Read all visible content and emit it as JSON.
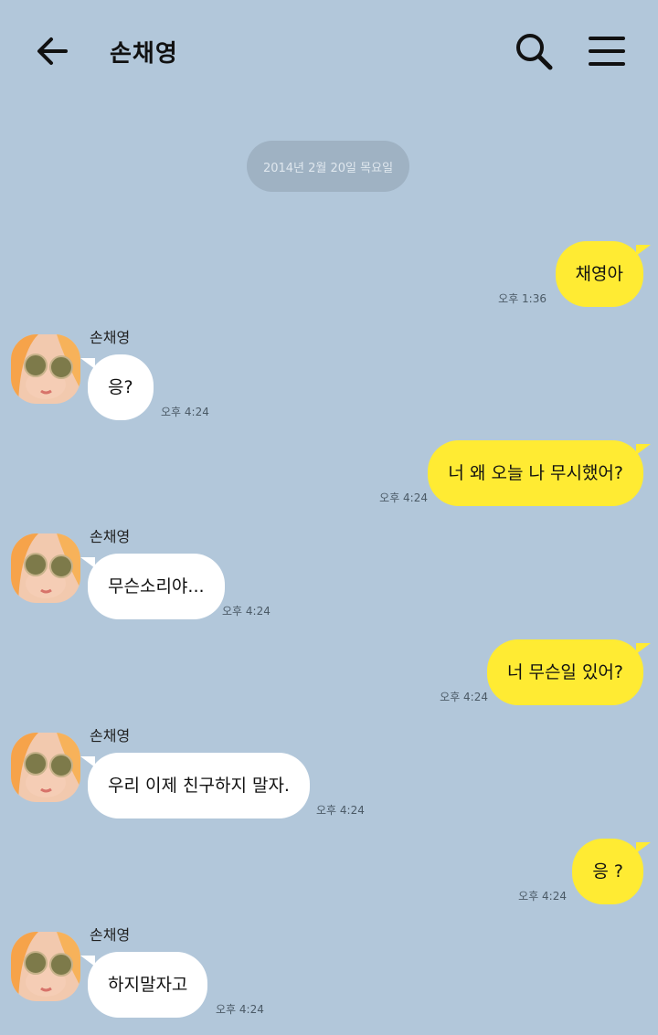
{
  "header": {
    "title": "손채영",
    "back_icon": "back-arrow-icon",
    "search_icon": "search-icon",
    "menu_icon": "menu-icon"
  },
  "date_divider": "2014년 2월 20일 목요일",
  "colors": {
    "background": "#b2c7da",
    "my_bubble": "#ffeb33",
    "their_bubble": "#ffffff",
    "date_pill": "#9fb2c3"
  },
  "messages": [
    {
      "from": "me",
      "text": "채영아",
      "time": "오후 1:36"
    },
    {
      "from": "them",
      "sender": "손채영",
      "text": "응?",
      "time": "오후 4:24"
    },
    {
      "from": "me",
      "text": "너 왜 오늘 나 무시했어?",
      "time": "오후 4:24"
    },
    {
      "from": "them",
      "sender": "손채영",
      "text": "무슨소리야...",
      "time": "오후 4:24"
    },
    {
      "from": "me",
      "text": "너 무슨일 있어?",
      "time": "오후 4:24"
    },
    {
      "from": "them",
      "sender": "손채영",
      "text": "우리 이제 친구하지 말자.",
      "time": "오후 4:24"
    },
    {
      "from": "me",
      "text": "응 ?",
      "time": "오후 4:24"
    },
    {
      "from": "them",
      "sender": "손채영",
      "text": "하지말자고",
      "time": "오후 4:24"
    }
  ]
}
